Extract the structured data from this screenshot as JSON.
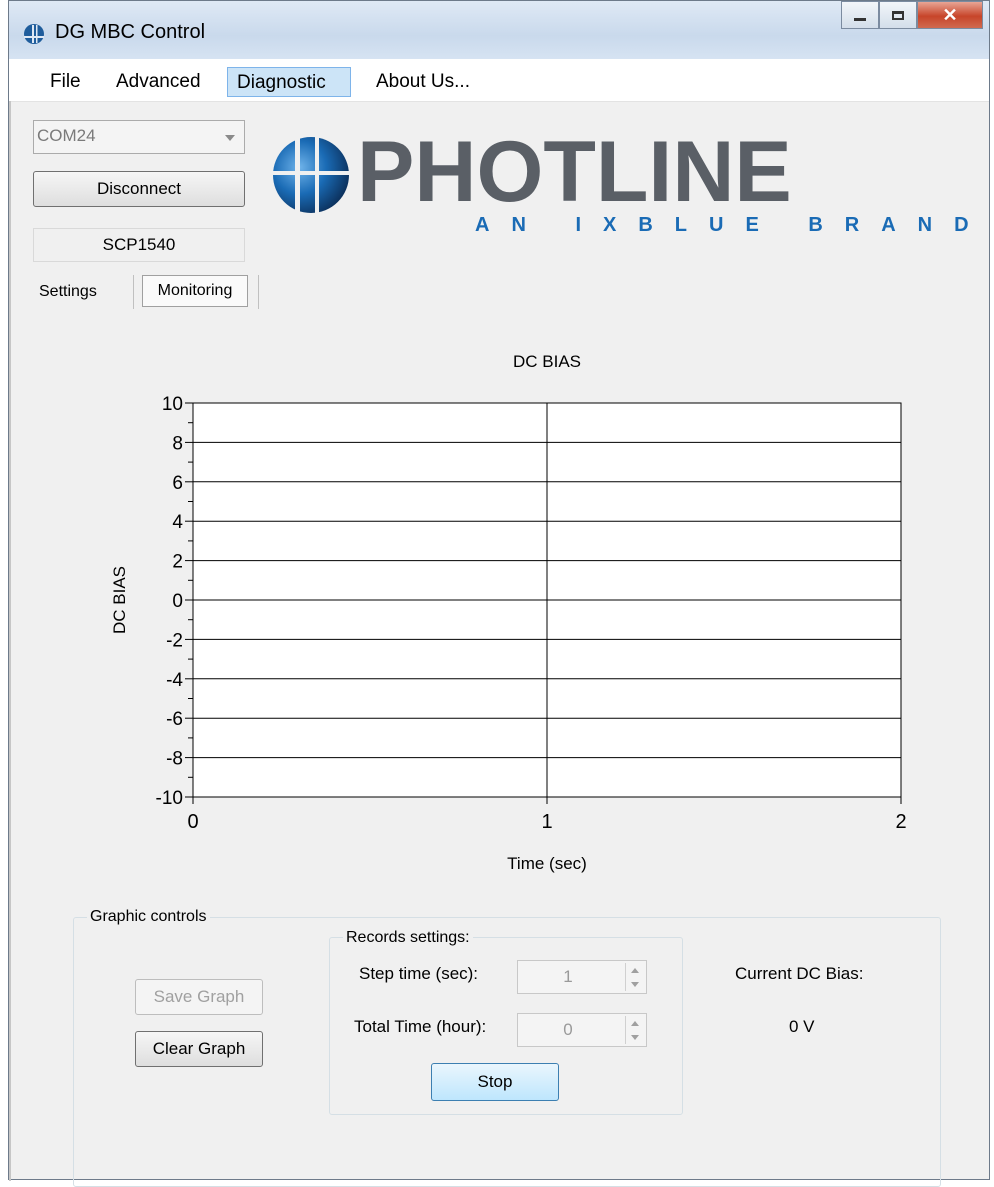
{
  "window": {
    "title": "DG MBC Control",
    "icon": "app-icon",
    "controls": [
      "minimize-icon",
      "maximize-icon",
      "close-icon"
    ]
  },
  "menu": {
    "items": [
      "File",
      "Advanced",
      "Diagnostic",
      "About Us..."
    ],
    "active": "Diagnostic"
  },
  "connection": {
    "port": "COM24",
    "button_label": "Disconnect",
    "device": "SCP1540"
  },
  "logo": {
    "main": "PHOTLINE",
    "sub": "AN IXBLUE BRAND",
    "colors": {
      "dark": "#5a5f66",
      "blue": "#1a6bb5"
    }
  },
  "tabs": [
    {
      "label": "Settings",
      "selected": false
    },
    {
      "label": "Monitoring",
      "selected": true
    }
  ],
  "chart_data": {
    "type": "line",
    "title": "DC BIAS",
    "xlabel": "Time (sec)",
    "ylabel": "DC BIAS",
    "xlim": [
      0,
      2
    ],
    "ylim": [
      -10,
      10
    ],
    "x_ticks": [
      0,
      1,
      2
    ],
    "y_ticks": [
      10,
      8,
      6,
      4,
      2,
      0,
      -2,
      -4,
      -6,
      -8,
      -10
    ],
    "y_tick_labels": [
      "10",
      "8",
      "6",
      "4",
      "2",
      "0",
      "-2",
      "-4",
      "-6",
      "-8",
      "-10"
    ],
    "grid": true,
    "series": []
  },
  "graphic_controls": {
    "label": "Graphic controls",
    "save_label": "Save Graph",
    "clear_label": "Clear Graph"
  },
  "records": {
    "label": "Records settings:",
    "step_label": "Step time (sec):",
    "step_value": "1",
    "total_label": "Total Time (hour):",
    "total_value": "0",
    "stop_label": "Stop"
  },
  "current": {
    "label": "Current DC Bias:",
    "value": "0 V"
  }
}
